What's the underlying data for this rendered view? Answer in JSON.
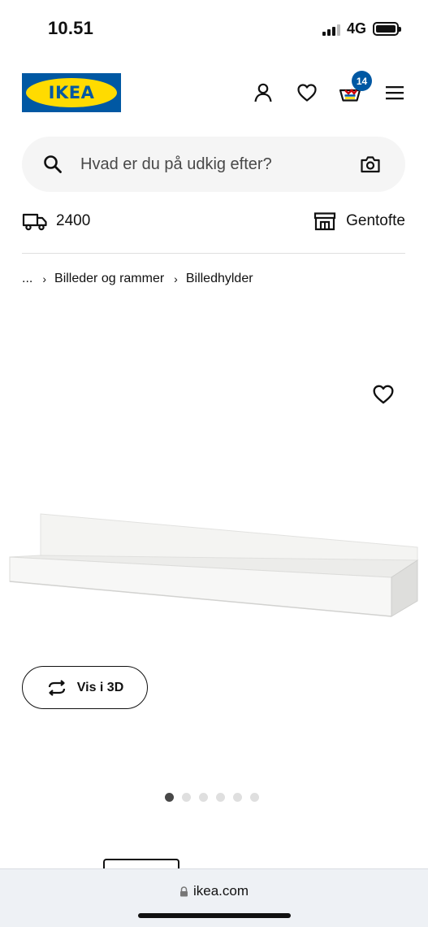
{
  "status_bar": {
    "time": "10.51",
    "network": "4G"
  },
  "header": {
    "logo_text": "IKEA",
    "cart_count": "14",
    "colors": {
      "brand_blue": "#0058a3",
      "brand_yellow": "#ffdb00"
    },
    "icons": [
      "person-icon",
      "heart-icon",
      "cart-icon",
      "menu-icon"
    ]
  },
  "search": {
    "placeholder": "Hvad er du på udkig efter?"
  },
  "location": {
    "postal_code": "2400",
    "store": "Gentofte"
  },
  "breadcrumb": {
    "items": [
      "...",
      "Billeder og rammer",
      "Billedhylder"
    ]
  },
  "product": {
    "view_3d_label": "Vis i 3D",
    "gallery_total": 6,
    "gallery_active": 1
  },
  "browser": {
    "url": "ikea.com"
  }
}
